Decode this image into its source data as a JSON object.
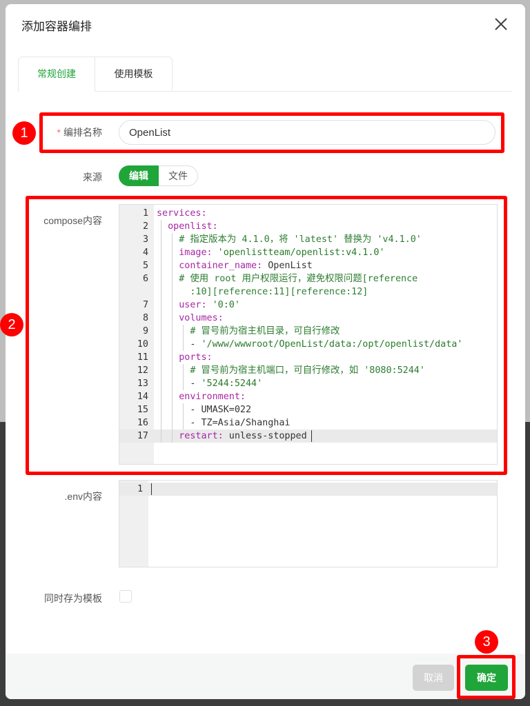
{
  "dialog": {
    "title": "添加容器编排",
    "close_icon": "close-icon"
  },
  "tabs": [
    {
      "label": "常规创建",
      "active": true
    },
    {
      "label": "使用模板",
      "active": false
    }
  ],
  "form": {
    "name_label": "编排名称",
    "name_required_mark": "*",
    "name_value": "OpenList",
    "source_label": "来源",
    "source_options": [
      "编辑",
      "文件"
    ],
    "source_selected": "编辑",
    "compose_label": "compose内容",
    "env_label": ".env内容",
    "save_template_label": "同时存为模板",
    "save_template_checked": false
  },
  "compose_editor": {
    "lines": [
      {
        "n": "1",
        "text": "services:"
      },
      {
        "n": "2",
        "text": "  openlist:"
      },
      {
        "n": "3",
        "text": "    # 指定版本为 4.1.0，将 'latest' 替换为 'v4.1.0'"
      },
      {
        "n": "4",
        "text": "    image: 'openlistteam/openlist:v4.1.0'"
      },
      {
        "n": "5",
        "text": "    container_name: OpenList"
      },
      {
        "n": "6",
        "text": "    # 使用 root 用户权限运行，避免权限问题[reference"
      },
      {
        "n": "",
        "text": "      :10][reference:11][reference:12]"
      },
      {
        "n": "7",
        "text": "    user: '0:0'"
      },
      {
        "n": "8",
        "text": "    volumes:"
      },
      {
        "n": "9",
        "text": "      # 冒号前为宿主机目录，可自行修改"
      },
      {
        "n": "10",
        "text": "      - '/www/wwwroot/OpenList/data:/opt/openlist/data'"
      },
      {
        "n": "11",
        "text": "    ports:"
      },
      {
        "n": "12",
        "text": "      # 冒号前为宿主机端口，可自行修改，如 '8080:5244'"
      },
      {
        "n": "13",
        "text": "      - '5244:5244'"
      },
      {
        "n": "14",
        "text": "    environment:"
      },
      {
        "n": "15",
        "text": "      - UMASK=022"
      },
      {
        "n": "16",
        "text": "      - TZ=Asia/Shanghai"
      },
      {
        "n": "17",
        "text": "    restart: unless-stopped"
      }
    ],
    "active_line": "17"
  },
  "env_editor": {
    "lines": [
      {
        "n": "1",
        "text": ""
      }
    ]
  },
  "footer": {
    "cancel_label": "取消",
    "confirm_label": "确定"
  },
  "annotations": [
    "1",
    "2",
    "3"
  ],
  "colors": {
    "accent": "#20a53a",
    "annotation": "#ff0000"
  }
}
